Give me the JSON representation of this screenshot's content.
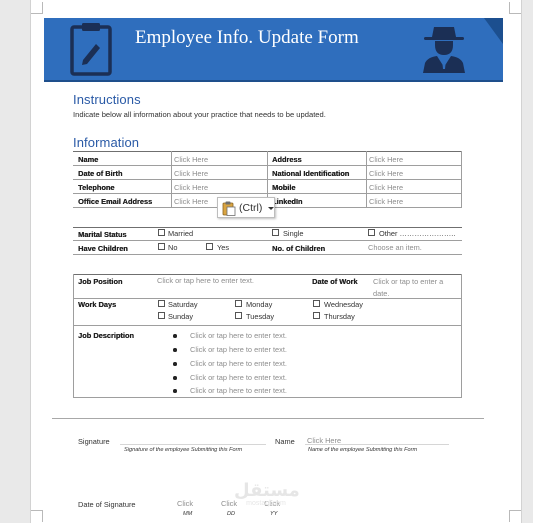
{
  "banner": {
    "title": "Employee Info. Update Form",
    "color": "#2f6ebd",
    "clipboard_icon": "clipboard-pen-icon",
    "agent_icon": "spy-agent-icon"
  },
  "instructions": {
    "heading": "Instructions",
    "text": "Indicate below all information about your practice that needs to be updated."
  },
  "information": {
    "heading": "Information",
    "rows": [
      {
        "left_label": "Name",
        "left_value": "Click Here",
        "right_label": "Address",
        "right_value": "Click Here"
      },
      {
        "left_label": "Date of Birth",
        "left_value": "Click Here",
        "right_label": "National Identification",
        "right_value": "Click Here"
      },
      {
        "left_label": "Telephone",
        "left_value": "Click Here",
        "right_label": "Mobile",
        "right_value": "Click Here"
      },
      {
        "left_label": "Office Email Address",
        "left_value": "Click Here",
        "right_label": "LinkedIn",
        "right_value": "Click Here"
      }
    ]
  },
  "paste_options": {
    "label": "(Ctrl)",
    "icon": "paste-clipboard-icon"
  },
  "personal": {
    "marital_label": "Marital Status",
    "marital_options": [
      "Married",
      "Single",
      "Other ………………….."
    ],
    "children_label": "Have Children",
    "children_options": [
      "No",
      "Yes"
    ],
    "children_count_label": "No. of Children",
    "children_count_value": "Choose an item."
  },
  "job": {
    "position_label": "Job Position",
    "position_value": "Click or tap here to enter text.",
    "date_label": "Date of Work",
    "date_value": "Click or tap to enter a date.",
    "workdays_label": "Work Days",
    "days": [
      "Saturday",
      "Monday",
      "Wednesday",
      "Sunday",
      "Tuesday",
      "Thursday"
    ],
    "description_label": "Job Description",
    "description_items": [
      "Click or tap here to enter text.",
      "Click or tap here to enter text.",
      "Click or tap here to enter text.",
      "Click or tap here to enter text.",
      "Click or tap here to enter text."
    ]
  },
  "signature": {
    "signature_label": "Signature",
    "signature_caption": "Signature of the employee Submitting this Form",
    "name_label": "Name",
    "name_value": "Click Here",
    "name_caption": "Name of the employee Submitting this Form",
    "date_label": "Date of Signature",
    "date_parts": [
      {
        "value": "Click",
        "caption": "MM"
      },
      {
        "value": "Click",
        "caption": "DD"
      },
      {
        "value": "Click",
        "caption": "YY"
      }
    ]
  },
  "watermark": {
    "text": "مستقل",
    "subtext": "mostaql.com"
  }
}
